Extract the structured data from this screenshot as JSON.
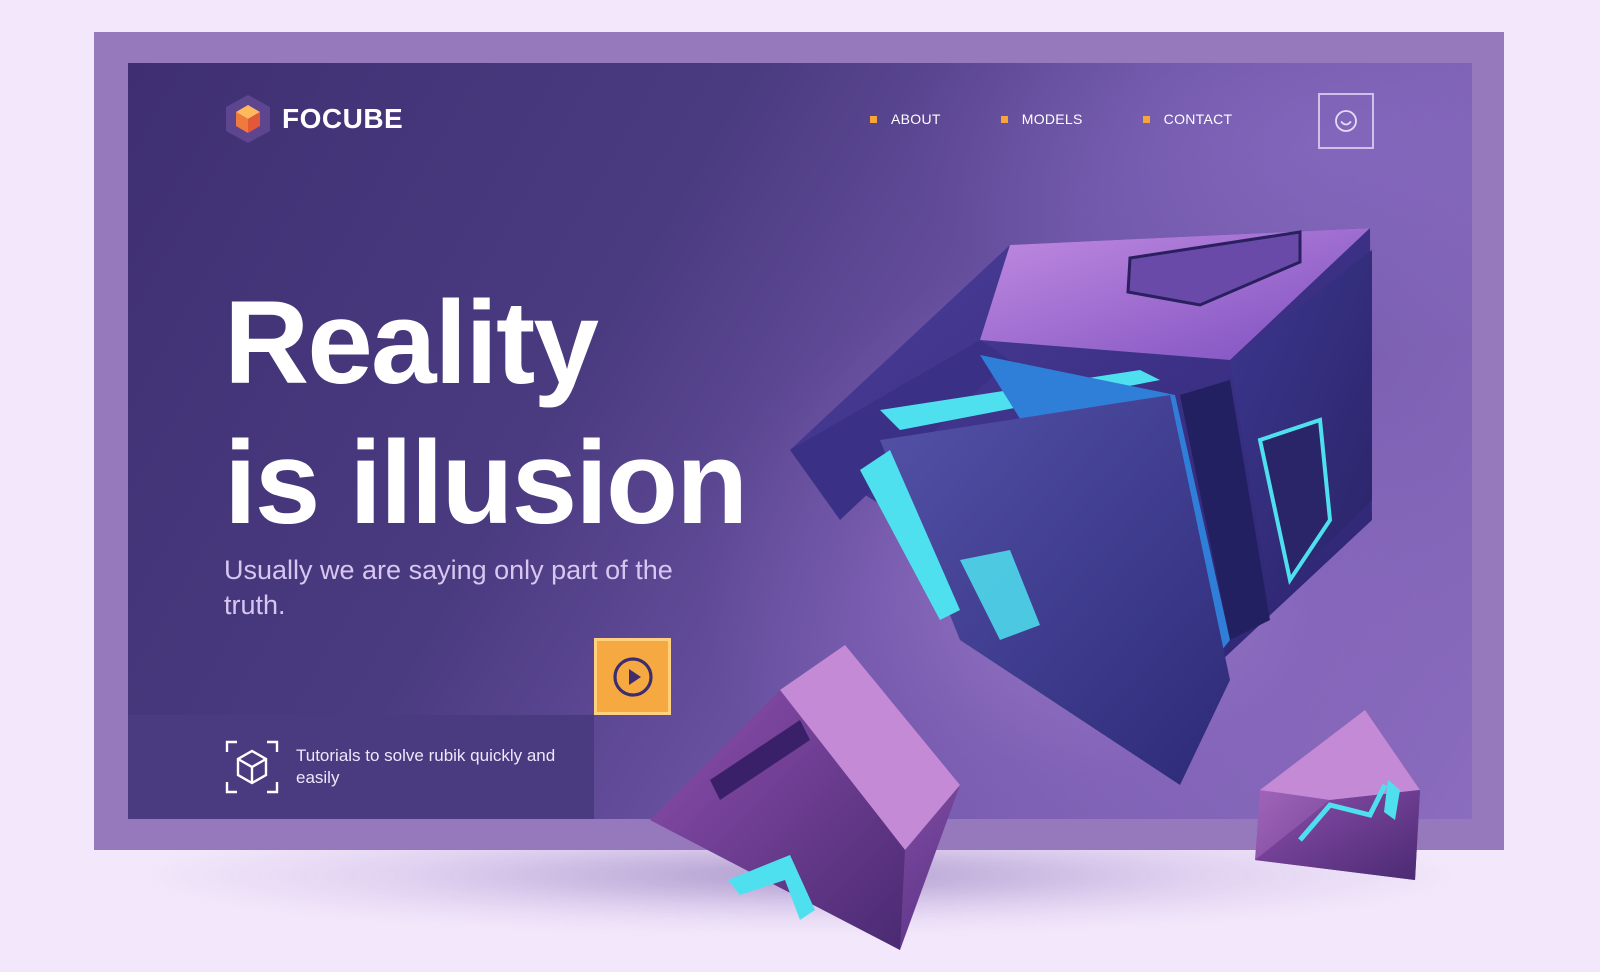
{
  "brand": {
    "name": "FOCUBE",
    "logo_icon": "hexagon-cube-logo",
    "accent_color": "#f5a53a"
  },
  "nav": {
    "items": [
      {
        "label": "ABOUT"
      },
      {
        "label": "MODELS"
      },
      {
        "label": "CONTACT"
      }
    ],
    "user_icon": "smiley-user-icon"
  },
  "hero": {
    "headline_line1": "Reality",
    "headline_line2": "is illusion",
    "subtitle": "Usually we are saying only part of the truth.",
    "play_icon": "play-icon",
    "play_color": "#f7a941"
  },
  "tutorial": {
    "icon": "3d-cube-scan-icon",
    "text": "Tutorials to solve rubik quickly and easily"
  },
  "colors": {
    "page_bg": "#f3e8fb",
    "frame": "#9679bc",
    "hero_dark": "#3f2f72",
    "hero_light": "#8b6cbf",
    "cyan_glow": "#4fe0f0"
  }
}
